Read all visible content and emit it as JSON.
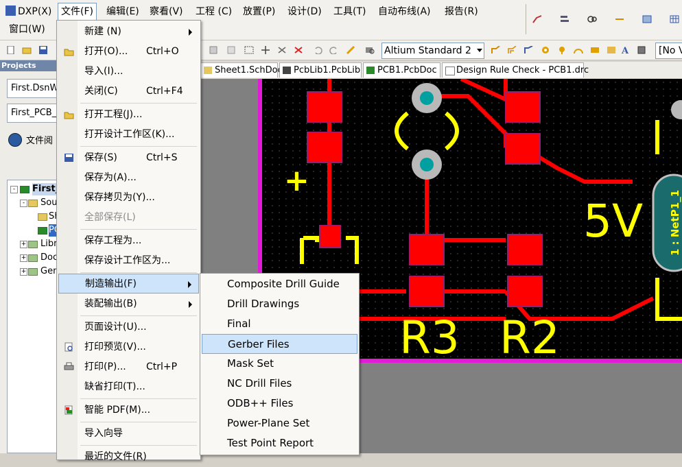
{
  "menubar": {
    "items": [
      "DXP(X)",
      "文件(F)",
      "编辑(E)",
      "察看(V)",
      "工程 (C)",
      "放置(P)",
      "设计(D)",
      "工具(T)",
      "自动布线(A)",
      "报告(R)"
    ],
    "second_row": "窗口(W)"
  },
  "toolbar": {
    "standard_combo": "Altium Standard 2",
    "right_combo": "[No V"
  },
  "panel": {
    "title": "Projects",
    "workspace_field": "First.DsnW",
    "project_field": "First_PCB_",
    "file_view_label": "文件阅",
    "tree": [
      "First_",
      "Sou",
      "Sh",
      "PC",
      "Libr",
      "Doc",
      "Gen"
    ]
  },
  "tabs": [
    "Sheet1.SchDoc",
    "PcbLib1.PcbLib",
    "PCB1.PcbDoc",
    "Design Rule Check - PCB1.drc"
  ],
  "pcb": {
    "labels": {
      "plus": "+",
      "five_v": "5V",
      "r3": "R3",
      "r2": "R2",
      "net": "1 : NetP1_1"
    },
    "colors": {
      "board": "#000000",
      "pad": "#ff0000",
      "pad_border": "#9a1e6e",
      "track": "#ff0000",
      "silk": "#ffff00",
      "outline": "#e21bd8",
      "via": "#00a0a0"
    }
  },
  "file_menu": {
    "items": [
      {
        "label": "新建 (N)",
        "shortcut": "",
        "submenu": true,
        "disabled": false
      },
      {
        "label": "打开(O)...",
        "shortcut": "Ctrl+O",
        "submenu": false,
        "disabled": false
      },
      {
        "label": "导入(I)...",
        "shortcut": "",
        "submenu": false,
        "disabled": false
      },
      {
        "label": "关闭(C)",
        "shortcut": "Ctrl+F4",
        "submenu": false,
        "disabled": false
      },
      {
        "label": "打开工程(J)...",
        "shortcut": "",
        "submenu": false,
        "disabled": false
      },
      {
        "label": "打开设计工作区(K)...",
        "shortcut": "",
        "submenu": false,
        "disabled": false
      },
      {
        "label": "保存(S)",
        "shortcut": "Ctrl+S",
        "submenu": false,
        "disabled": false
      },
      {
        "label": "保存为(A)...",
        "shortcut": "",
        "submenu": false,
        "disabled": false
      },
      {
        "label": "保存拷贝为(Y)...",
        "shortcut": "",
        "submenu": false,
        "disabled": false
      },
      {
        "label": "全部保存(L)",
        "shortcut": "",
        "submenu": false,
        "disabled": true
      },
      {
        "label": "保存工程为...",
        "shortcut": "",
        "submenu": false,
        "disabled": false
      },
      {
        "label": "保存设计工作区为...",
        "shortcut": "",
        "submenu": false,
        "disabled": false
      },
      {
        "label": "制造输出(F)",
        "shortcut": "",
        "submenu": true,
        "disabled": false
      },
      {
        "label": "装配输出(B)",
        "shortcut": "",
        "submenu": true,
        "disabled": false
      },
      {
        "label": "页面设计(U)...",
        "shortcut": "",
        "submenu": false,
        "disabled": false
      },
      {
        "label": "打印预览(V)...",
        "shortcut": "",
        "submenu": false,
        "disabled": false
      },
      {
        "label": "打印(P)...",
        "shortcut": "Ctrl+P",
        "submenu": false,
        "disabled": false
      },
      {
        "label": "缺省打印(T)...",
        "shortcut": "",
        "submenu": false,
        "disabled": false
      },
      {
        "label": "智能 PDF(M)...",
        "shortcut": "",
        "submenu": false,
        "disabled": false
      },
      {
        "label": "导入向导",
        "shortcut": "",
        "submenu": false,
        "disabled": false
      },
      {
        "label": "最近的文件(R)",
        "shortcut": "",
        "submenu": true,
        "disabled": false
      }
    ],
    "highlighted": "制造输出(F)"
  },
  "fabrication_submenu": {
    "items": [
      "Composite Drill Guide",
      "Drill Drawings",
      "Final",
      "Gerber Files",
      "Mask Set",
      "NC Drill Files",
      "ODB++ Files",
      "Power-Plane Set",
      "Test Point Report"
    ],
    "highlighted": "Gerber Files"
  }
}
